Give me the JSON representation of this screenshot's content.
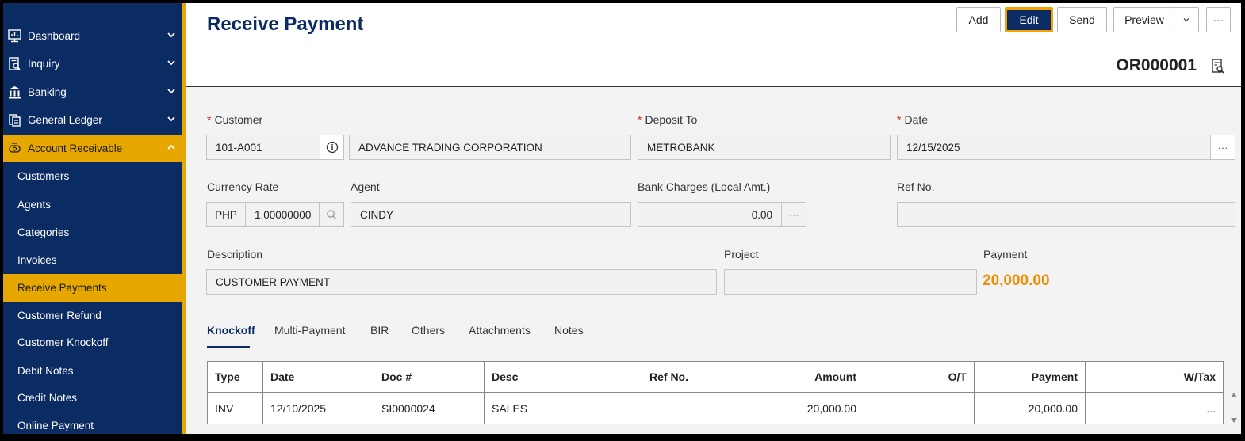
{
  "sidebar": {
    "items": [
      {
        "label": "Dashboard",
        "icon": "dashboard-icon"
      },
      {
        "label": "Inquiry",
        "icon": "inquiry-icon"
      },
      {
        "label": "Banking",
        "icon": "bank-icon"
      },
      {
        "label": "General Ledger",
        "icon": "ledger-icon"
      },
      {
        "label": "Account Receivable",
        "icon": "receivable-icon"
      }
    ],
    "subitems": [
      {
        "label": "Customers"
      },
      {
        "label": "Agents"
      },
      {
        "label": "Categories"
      },
      {
        "label": "Invoices"
      },
      {
        "label": "Receive Payments"
      },
      {
        "label": "Customer Refund"
      },
      {
        "label": "Customer Knockoff"
      },
      {
        "label": "Debit Notes"
      },
      {
        "label": "Credit Notes"
      },
      {
        "label": "Online Payment"
      }
    ]
  },
  "header": {
    "title": "Receive Payment",
    "doc_no": "OR000001"
  },
  "toolbar": {
    "add": "Add",
    "edit": "Edit",
    "send": "Send",
    "preview": "Preview",
    "more": "···"
  },
  "form": {
    "customer_label": "Customer",
    "customer_code": "101-A001",
    "customer_name": "ADVANCE TRADING CORPORATION",
    "deposit_label": "Deposit To",
    "deposit_value": "METROBANK",
    "date_label": "Date",
    "date_value": "12/15/2025",
    "currency_label": "Currency Rate",
    "currency_code": "PHP",
    "currency_rate": "1.00000000",
    "agent_label": "Agent",
    "agent_value": "CINDY",
    "bank_charges_label": "Bank Charges (Local Amt.)",
    "bank_charges_value": "0.00",
    "ref_label": "Ref No.",
    "ref_value": "",
    "desc_label": "Description",
    "desc_value": "CUSTOMER PAYMENT",
    "project_label": "Project",
    "project_value": "",
    "payment_label": "Payment",
    "payment_value": "20,000.00",
    "required_mark": "*",
    "ellipsis": "···"
  },
  "tabs": [
    "Knockoff",
    "Multi-Payment",
    "BIR",
    "Others",
    "Attachments",
    "Notes"
  ],
  "table": {
    "headers": [
      "Type",
      "Date",
      "Doc #",
      "Desc",
      "Ref No.",
      "Amount",
      "O/T",
      "Payment",
      "W/Tax"
    ],
    "rows": [
      {
        "type": "INV",
        "date": "12/10/2025",
        "doc": "SI0000024",
        "desc": "SALES",
        "ref": "",
        "amount": "20,000.00",
        "ot": "",
        "payment": "20,000.00",
        "wtax": "..."
      }
    ]
  },
  "colors": {
    "navy": "#0b2b63",
    "accent": "#e6a700",
    "payment": "#f28c00",
    "link": "#1aa0d8"
  }
}
